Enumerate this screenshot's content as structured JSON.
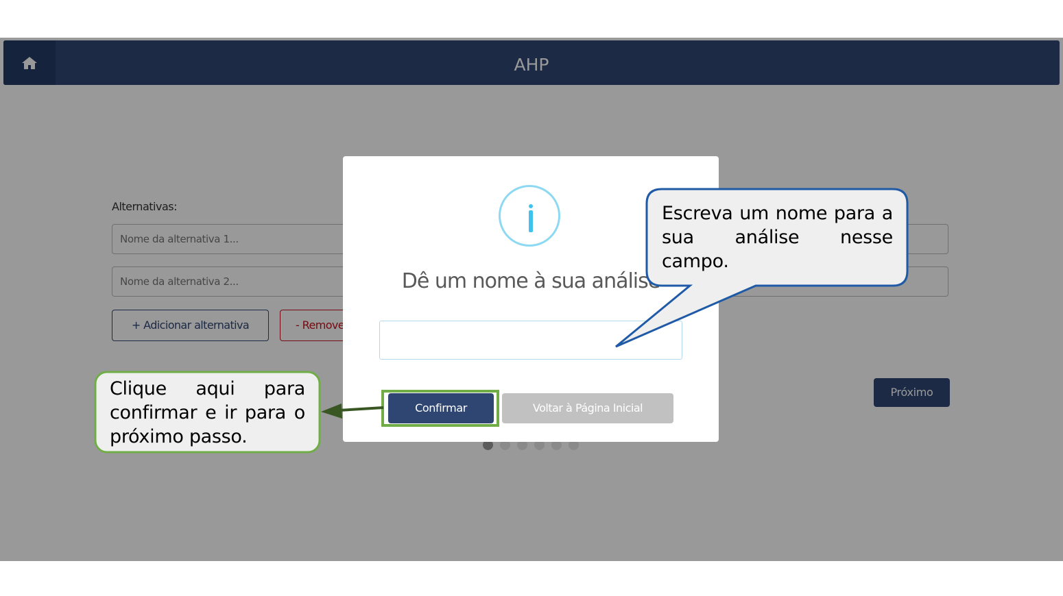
{
  "navbar": {
    "title": "AHP",
    "home_icon": "home-icon"
  },
  "form": {
    "alternatives_label": "Alternativas:",
    "alternative_1_placeholder": "Nome da alternativa 1...",
    "alternative_2_placeholder": "Nome da alternativa 2...",
    "add_button": "+ Adicionar alternativa",
    "remove_button": "- Remover alternativa",
    "next_button": "Próximo",
    "step_count": 6,
    "active_step": 1
  },
  "modal": {
    "icon": "info-icon",
    "title": "Dê um nome à sua análise",
    "name_value": "",
    "confirm_button": "Confirmar",
    "back_button": "Voltar à Página Inicial"
  },
  "annotations": {
    "green_callout": "Clique aqui para confirmar e ir para o próximo passo.",
    "blue_callout": "Escreva um nome para a sua análise nesse campo.",
    "green_color": "#70ad47",
    "blue_color": "#1f5aa6",
    "arrow_color": "#385723"
  }
}
